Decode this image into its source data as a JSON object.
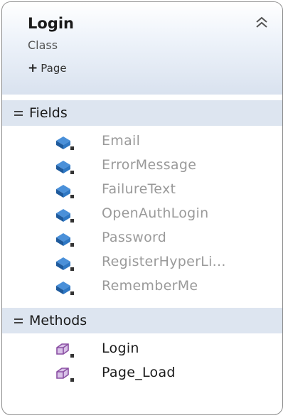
{
  "class_shape": {
    "title": "Login",
    "stereotype": "Class",
    "inherits_label": "Page",
    "collapse_icon": "double-chevron-up-icon"
  },
  "fields_section": {
    "label": "Fields",
    "items": [
      "Email",
      "ErrorMessage",
      "FailureText",
      "OpenAuthLogin",
      "Password",
      "RegisterHyperLi...",
      "RememberMe"
    ]
  },
  "methods_section": {
    "label": "Methods",
    "items": [
      "Login",
      "Page_Load"
    ]
  },
  "colors": {
    "header_gradient_bottom": "#d9e2ef",
    "section_band": "#dde5f0",
    "field_icon": "#1e6fb5",
    "method_icon": "#8a4fa3",
    "field_text": "#9a9a9a"
  }
}
